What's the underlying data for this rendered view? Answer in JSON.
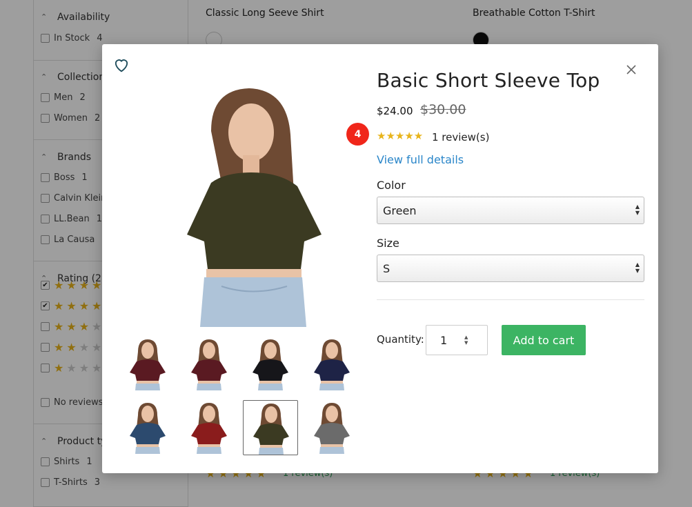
{
  "sidebar": {
    "availability": {
      "title": "Availability",
      "options": [
        {
          "label": "In Stock",
          "count": "4"
        }
      ]
    },
    "collection": {
      "title": "Collection",
      "options": [
        {
          "label": "Men",
          "count": "2"
        },
        {
          "label": "Women",
          "count": "2"
        }
      ]
    },
    "brands": {
      "title": "Brands",
      "options": [
        {
          "label": "Boss",
          "count": "1"
        },
        {
          "label": "Calvin Klein",
          "count": ""
        },
        {
          "label": "LL.Bean",
          "count": "1"
        },
        {
          "label": "La Causa",
          "count": ""
        }
      ]
    },
    "rating": {
      "title": "Rating (2)",
      "no_reviews": "No reviews",
      "rows": [
        {
          "filled": 5,
          "checked": true
        },
        {
          "filled": 4,
          "checked": true
        },
        {
          "filled": 3,
          "checked": false
        },
        {
          "filled": 2,
          "checked": false
        },
        {
          "filled": 1,
          "checked": false
        }
      ]
    },
    "product_type": {
      "title": "Product ty",
      "options": [
        {
          "label": "Shirts",
          "count": "1"
        },
        {
          "label": "T-Shirts",
          "count": "3"
        }
      ]
    }
  },
  "background_products": [
    {
      "title": "Classic Long Seeve Shirt",
      "swatch_color": "#ffffff",
      "review": "1 review(s)"
    },
    {
      "title": "Breathable Cotton T-Shirt",
      "swatch_color": "#111111",
      "review": "1 review(s)"
    }
  ],
  "modal": {
    "title": "Basic Short Sleeve Top",
    "price": "$24.00",
    "old_price": "$30.00",
    "badge": "4",
    "stars": "★★★★★",
    "review_text": "1 review(s)",
    "full_details_label": "View full details",
    "color_label": "Color",
    "color_value": "Green",
    "size_label": "Size",
    "size_value": "S",
    "quantity_label": "Quantity:",
    "quantity_value": "1",
    "add_to_cart_label": "Add to cart",
    "main_image_color": "#3b3a22",
    "thumbnails": [
      {
        "color": "#5a1a22",
        "selected": false
      },
      {
        "color": "#5a1a22",
        "selected": false
      },
      {
        "color": "#16161a",
        "selected": false
      },
      {
        "color": "#1e2346",
        "selected": false
      },
      {
        "color": "#2c4a6e",
        "selected": false
      },
      {
        "color": "#8a1c1c",
        "selected": false
      },
      {
        "color": "#3b3a22",
        "selected": true
      },
      {
        "color": "#6b6b6b",
        "selected": false
      }
    ]
  }
}
